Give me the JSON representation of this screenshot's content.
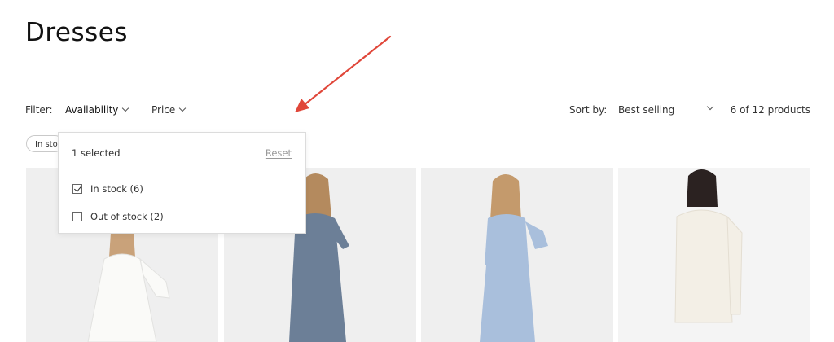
{
  "page": {
    "title": "Dresses"
  },
  "filters": {
    "label": "Filter:",
    "availability_label": "Availability",
    "price_label": "Price"
  },
  "sort": {
    "label": "Sort by:",
    "selected": "Best selling"
  },
  "product_count": "6 of 12 products",
  "active_chip": {
    "label": "In stock"
  },
  "availability_dropdown": {
    "selected_text": "1 selected",
    "reset_label": "Reset",
    "options": [
      {
        "label": "In stock (6)",
        "checked": true
      },
      {
        "label": "Out of stock (2)",
        "checked": false
      }
    ]
  },
  "colors": {
    "annotation_arrow": "#e0473a",
    "card_bg": "#efefef"
  },
  "products": [
    {
      "dress_color": "#f7f7f5"
    },
    {
      "dress_color": "#6c7f97"
    },
    {
      "dress_color": "#a9bfdc"
    },
    {
      "dress_color": "#f3efe6"
    }
  ]
}
